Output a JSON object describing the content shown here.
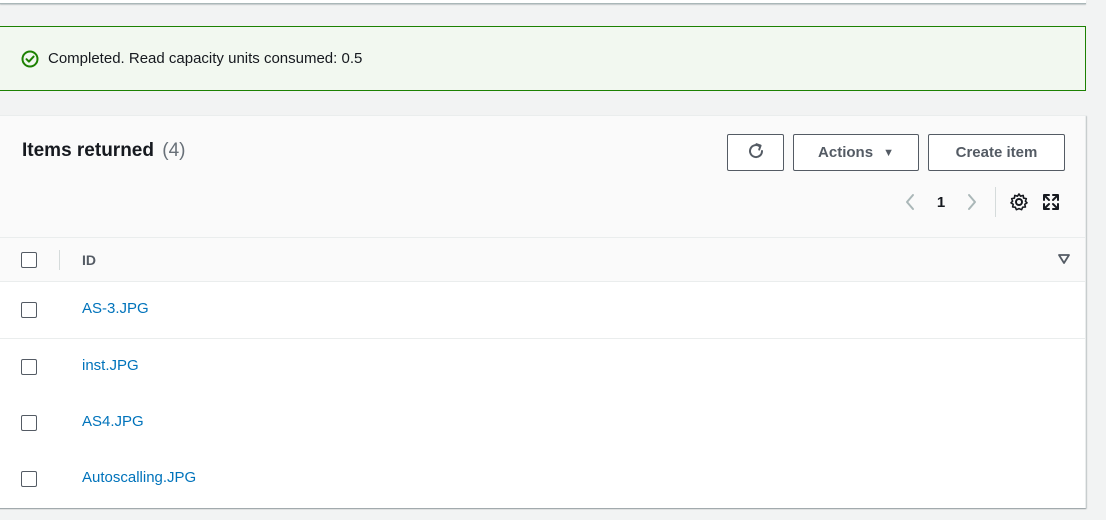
{
  "alert": {
    "status": "success",
    "icon": "check-circle-icon",
    "message": "Completed. Read capacity units consumed: 0.5",
    "color": "#1d8102"
  },
  "panel": {
    "title": "Items returned",
    "count": "(4)",
    "buttons": {
      "refresh_icon": "refresh-icon",
      "actions_label": "Actions",
      "actions_caret": "▼",
      "create_label": "Create item"
    },
    "pagination": {
      "current_page": "1",
      "prev_icon": "chevron-left-icon",
      "next_icon": "chevron-right-icon",
      "settings_icon": "gear-icon",
      "fullscreen_icon": "expand-icon"
    }
  },
  "table": {
    "columns": [
      {
        "label": "ID"
      }
    ],
    "sort_icon": "sort-down-icon",
    "rows": [
      {
        "id": "AS-3.JPG"
      },
      {
        "id": "inst.JPG"
      },
      {
        "id": "AS4.JPG"
      },
      {
        "id": "Autoscalling.JPG"
      }
    ]
  },
  "colors": {
    "link": "#0073bb",
    "success_border": "#1d8102",
    "success_bg": "#f2f8f0",
    "button_border": "#545b64"
  }
}
